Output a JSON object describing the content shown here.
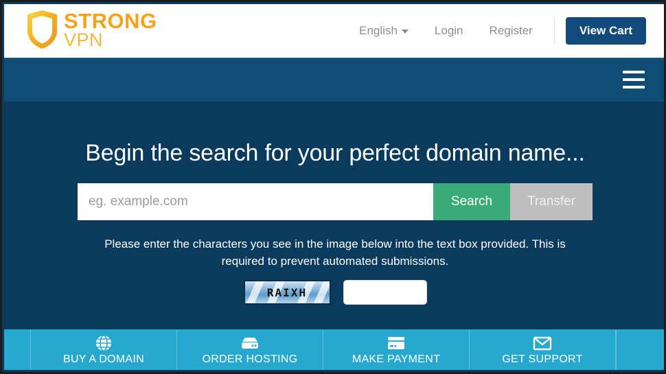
{
  "colors": {
    "header_bg": "#ffffff",
    "navbar_bg": "#0f4d77",
    "hero_bg": "#0a3a5c",
    "cart_button": "#134a7c",
    "search_button": "#3aab78",
    "transfer_button": "#bebebe",
    "action_bar": "#27a9cf",
    "logo_orange": "#f6a21d",
    "logo_gold": "#f3b73c"
  },
  "header": {
    "logo": {
      "icon": "shield-icon",
      "primary_text": "STRONG",
      "secondary_text": "VPN"
    },
    "language": {
      "label": "English",
      "caret_icon": "chevron-down-icon"
    },
    "login_label": "Login",
    "register_label": "Register",
    "cart_label": "View Cart"
  },
  "navbar": {
    "menu_icon": "hamburger-menu-icon"
  },
  "hero": {
    "title": "Begin the search for your perfect domain name...",
    "search": {
      "placeholder": "eg. example.com",
      "value": "",
      "search_label": "Search",
      "transfer_label": "Transfer"
    },
    "captcha": {
      "note": "Please enter the characters you see in the image below into the text box provided. This is required to prevent automated submissions.",
      "image_text": "RAIXH",
      "input_value": "",
      "input_placeholder": ""
    }
  },
  "action_bar": {
    "items": [
      {
        "label": "BUY A DOMAIN",
        "icon": "globe-icon"
      },
      {
        "label": "ORDER HOSTING",
        "icon": "server-icon"
      },
      {
        "label": "MAKE PAYMENT",
        "icon": "credit-card-icon"
      },
      {
        "label": "GET SUPPORT",
        "icon": "envelope-icon"
      }
    ]
  }
}
